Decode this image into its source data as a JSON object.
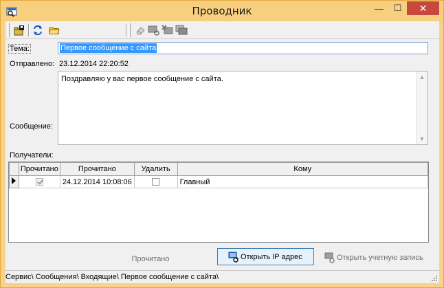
{
  "window": {
    "title": "Проводник"
  },
  "titlebar_buttons": {
    "minimize": "—",
    "maximize": "☐",
    "close": "✕"
  },
  "toolbar": {
    "buttons": [
      {
        "icon": "save-icon",
        "enabled": true
      },
      {
        "icon": "refresh-icon",
        "enabled": true
      },
      {
        "icon": "folder-open-icon",
        "enabled": true
      },
      {
        "icon": "eraser-icon",
        "enabled": false
      },
      {
        "icon": "monitor-refresh-icon",
        "enabled": false
      },
      {
        "icon": "monitor-delete-icon",
        "enabled": false
      },
      {
        "icon": "monitors-icon",
        "enabled": false
      }
    ]
  },
  "form": {
    "subject_label": "Тема:",
    "subject_value": "Первое сообщение с сайта",
    "sent_label": "Отправлено:",
    "sent_value": "23.12.2014 22:20:52",
    "message_label": "Сообщение:",
    "message_value": "Поздравляю у вас первое сообщение с сайта.",
    "recipients_label": "Получатели:"
  },
  "recipients_table": {
    "columns": [
      "Прочитано",
      "Прочитано",
      "Удалить",
      "Кому"
    ],
    "rows": [
      {
        "read_flag": true,
        "read_at": "24.12.2014 10:08:06",
        "delete": false,
        "to": "Главный"
      }
    ]
  },
  "actions": {
    "read_label": "Прочитано",
    "open_ip_label": "Открыть IP адрес",
    "open_account_label": "Открыть учетную запись"
  },
  "status": {
    "path": "Сервис\\ Сообщения\\ Входящие\\ Первое сообщение с сайта\\"
  },
  "colors": {
    "titlebar": "#f7cf7f",
    "close_button": "#c7483d",
    "selection": "#3399ff",
    "primary_button_bg": "#e5f1fb",
    "primary_button_border": "#3c7fb1"
  }
}
